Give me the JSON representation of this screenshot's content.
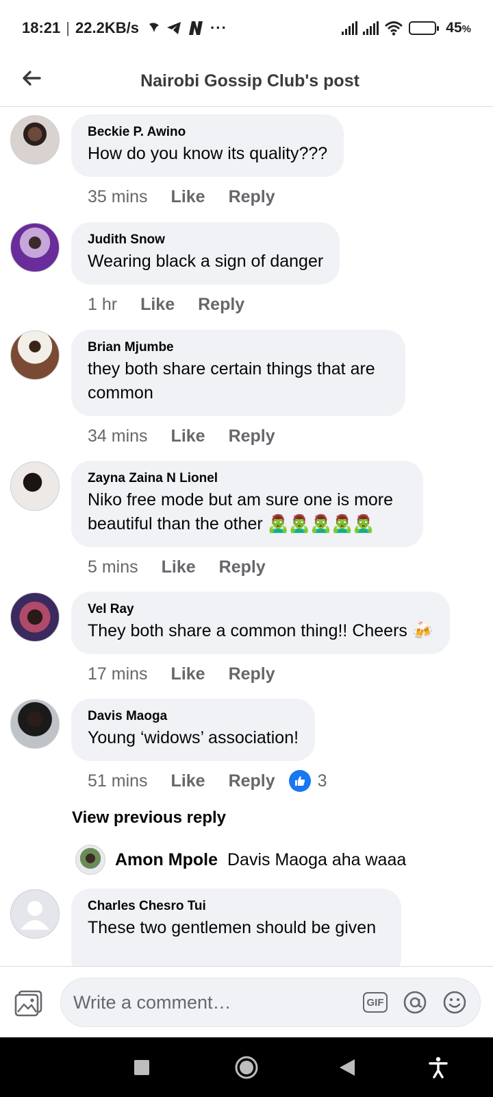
{
  "status_bar": {
    "time": "18:21",
    "network_speed": "22.2KB/s",
    "battery_percent": "45",
    "battery_level": 0.45
  },
  "header": {
    "title": "Nairobi Gossip Club's post"
  },
  "comments": [
    {
      "author": "Beckie P. Awino",
      "text": "How do you know its quality???",
      "time": "35 mins",
      "like_label": "Like",
      "reply_label": "Reply"
    },
    {
      "author": "Judith Snow",
      "text": "Wearing black a sign of danger",
      "time": "1 hr",
      "like_label": "Like",
      "reply_label": "Reply"
    },
    {
      "author": "Brian Mjumbe",
      "text": "they both share certain things that are common",
      "time": "34 mins",
      "like_label": "Like",
      "reply_label": "Reply"
    },
    {
      "author": "Zayna Zaina N Lionel",
      "text": "Niko free mode but am sure one is more beautiful than the other 🧟‍♂️🧟‍♂️🧟‍♂️🧟‍♂️🧟‍♂️",
      "time": "5 mins",
      "like_label": "Like",
      "reply_label": "Reply"
    },
    {
      "author": "Vel Ray",
      "text": "They both share a common thing!! Cheers 🍻",
      "time": "17 mins",
      "like_label": "Like",
      "reply_label": "Reply"
    },
    {
      "author": "Davis Maoga",
      "text": "Young ‘widows’ association!",
      "time": "51 mins",
      "like_label": "Like",
      "reply_label": "Reply",
      "reaction_count": "3"
    },
    {
      "author": "Charles Chesro Tui",
      "text": "These two gentlemen should be given"
    }
  ],
  "view_previous_reply": "View previous reply",
  "reply": {
    "author": "Amon Mpole",
    "text": "Davis Maoga aha waaa"
  },
  "composer": {
    "placeholder": "Write a comment…",
    "gif_label": "GIF"
  },
  "icons": {
    "back": "arrow-left-icon",
    "photo": "photo-icon",
    "gif": "gif-icon",
    "mention": "at-sign-icon",
    "emoji": "emoji-icon",
    "like_reaction": "thumbs-up-icon"
  },
  "colors": {
    "accent": "#1877f2",
    "bubble": "#f0f2f5",
    "secondary_text": "#65676b"
  }
}
